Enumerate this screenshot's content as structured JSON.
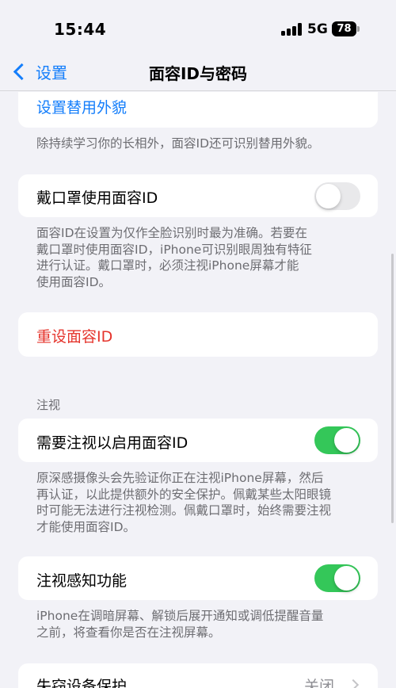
{
  "status_bar": {
    "time": "15:44",
    "network": "5G",
    "battery": "78"
  },
  "nav": {
    "back_label": "设置",
    "title": "面容ID与密码"
  },
  "rows": {
    "alternate_appearance": "设置替用外貌",
    "alternate_appearance_note": "除持续学习你的长相外，面容ID还可识别替用外貌。",
    "mask_label": "戴口罩使用面容ID",
    "mask_note": [
      "面容ID在设置为仅作全脸识别时最为准确。若要在",
      "戴口罩时使用面容ID，iPhone可识别眼周独有特征",
      "进行认证。戴口罩时，必须注视iPhone屏幕才能",
      "使用面容ID。"
    ],
    "reset_label": "重设面容ID",
    "attention_header": "注视",
    "require_attention_label": "需要注视以启用面容ID",
    "require_attention_note": [
      "原深感摄像头会先验证你正在注视iPhone屏幕，然后",
      "再认证，以此提供额外的安全保护。佩戴某些太阳眼镜",
      "时可能无法进行注视检测。佩戴口罩时，始终需要注视",
      "才能使用面容ID。"
    ],
    "attention_aware_label": "注视感知功能",
    "attention_aware_note": [
      "iPhone在调暗屏幕、解锁后展开通知或调低提醒音量",
      "之前，将查看你是否在注视屏幕。"
    ],
    "stolen_device_label": "失窃设备保护",
    "stolen_device_value": "关闭"
  },
  "toggles": {
    "mask": false,
    "require_attention": true,
    "attention_aware": true
  },
  "colors": {
    "accent": "#147efb",
    "destructive": "#e5342c",
    "toggle_on": "#34c759",
    "background": "#f2f2f7"
  }
}
